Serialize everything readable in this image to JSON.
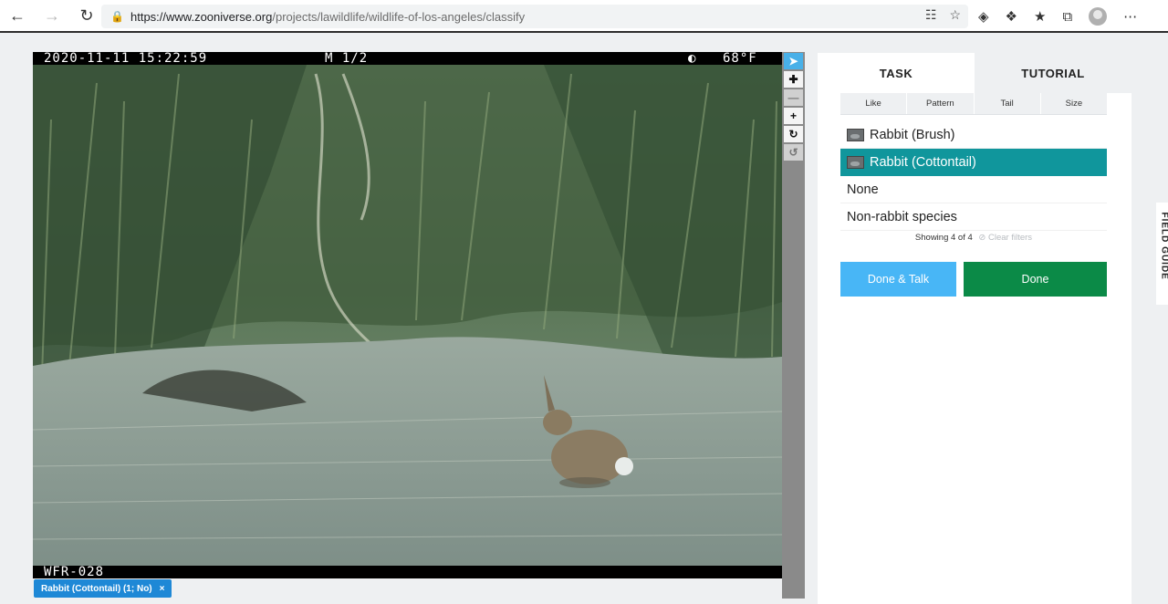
{
  "browser": {
    "url_host": "https://www.zooniverse.org",
    "url_path": "/projects/lawildlife/wildlife-of-los-angeles/classify",
    "icons": [
      "back-arrow-icon",
      "forward-arrow-icon",
      "reload-icon",
      "lock-icon",
      "reader-icon",
      "favorite-star-icon",
      "extension-pin-icon",
      "puzzle-icon",
      "favorites-icon",
      "collections-icon",
      "profile-icon",
      "more-icon"
    ]
  },
  "camera": {
    "datetime": "2020-11-11 15:22:59",
    "frame": "M 1/2",
    "moon": "◐",
    "temperature": "68°F",
    "station": "WFR-028"
  },
  "tools": [
    "pointer-icon",
    "pan-icon",
    "zoom-out-icon",
    "zoom-in-icon",
    "rotate-icon",
    "reset-icon"
  ],
  "annotation_tag": {
    "label": "Rabbit (Cottontail) (1; No)",
    "close": "×"
  },
  "panel": {
    "tabs": [
      {
        "label": "TASK"
      },
      {
        "label": "TUTORIAL"
      }
    ],
    "filters": [
      "Like",
      "Pattern",
      "Tail",
      "Size"
    ],
    "choices": [
      {
        "label": "Rabbit (Brush)"
      },
      {
        "label": "Rabbit (Cottontail)"
      },
      {
        "label": "None"
      },
      {
        "label": "Non-rabbit species"
      }
    ],
    "showing": "Showing 4 of 4",
    "clear_filters": "⊘ Clear filters",
    "done_talk": "Done & Talk",
    "done": "Done"
  },
  "field_guide": "FIELD GUIDE",
  "colors": {
    "selected": "#10969c",
    "done": "#0b8a47",
    "talk": "#48b6f6",
    "tool_active": "#48b0e8"
  }
}
